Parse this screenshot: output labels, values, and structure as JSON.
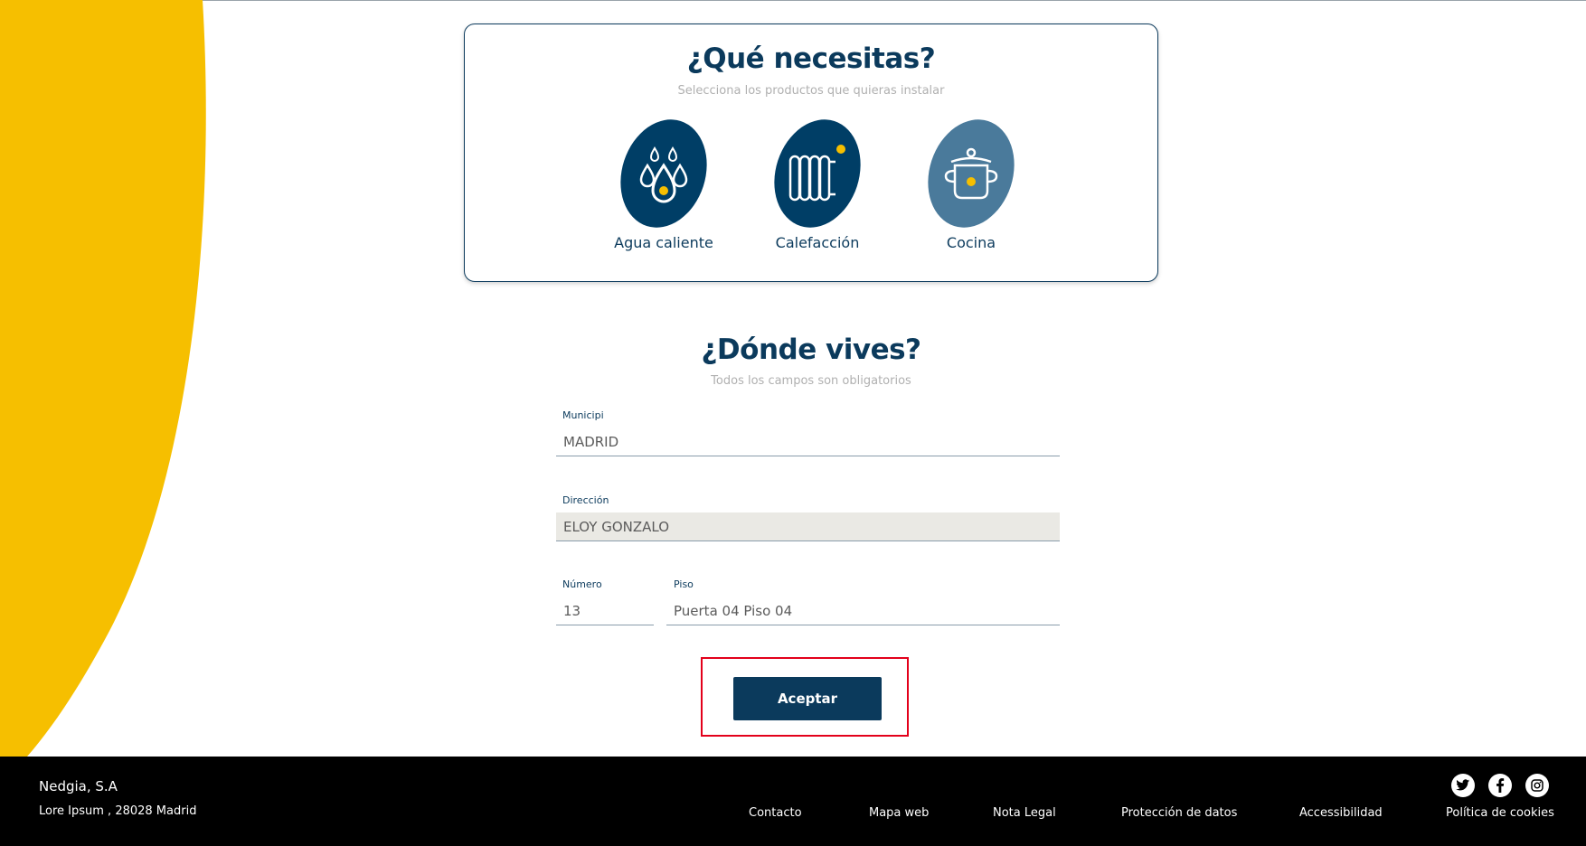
{
  "products": {
    "title": "¿Qué necesitas?",
    "subtitle": "Selecciona los productos que quieras instalar",
    "items": [
      {
        "label": "Agua caliente",
        "icon": "water-drops-icon",
        "color": "#003e66"
      },
      {
        "label": "Calefacción",
        "icon": "radiator-icon",
        "color": "#003e66"
      },
      {
        "label": "Cocina",
        "icon": "cooking-pot-icon",
        "color": "#4a7a9b"
      }
    ]
  },
  "address": {
    "title": "¿Dónde vives?",
    "subtitle": "Todos los campos son obligatorios",
    "municipio_label": "Municipi",
    "municipio_value": "MADRID",
    "direccion_label": "Dirección",
    "direccion_value": "ELOY GONZALO",
    "numero_label": "Número",
    "numero_value": "13",
    "piso_label": "Piso",
    "piso_value": "Puerta 04 Piso 04"
  },
  "actions": {
    "accept_label": "Aceptar"
  },
  "footer": {
    "company": "Nedgia, S.A",
    "address": "Lore Ipsum , 28028 Madrid",
    "links": [
      "Contacto",
      "Mapa web",
      "Nota Legal",
      "Protección de datos",
      "Accessibilidad",
      "Política de cookies"
    ],
    "social": [
      "twitter-icon",
      "facebook-icon",
      "instagram-icon"
    ]
  },
  "colors": {
    "brand_navy": "#0b3a5c",
    "brand_yellow": "#f6bf00",
    "highlight_red": "#e3001b",
    "readonly_bg": "#eae9e4"
  }
}
